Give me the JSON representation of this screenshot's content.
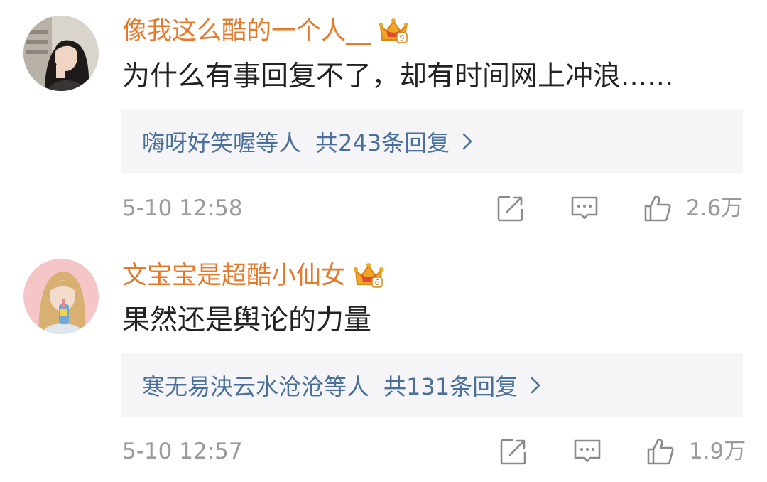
{
  "comments": [
    {
      "username": "像我这么酷的一个人__",
      "text": "为什么有事回复不了，却有时间网上冲浪......",
      "reply_users": "嗨呀好笑喔",
      "reply_suffix": "等人",
      "reply_count": "共243条回复",
      "timestamp": "5-10 12:58",
      "likes": "2.6万",
      "crown_level": "9"
    },
    {
      "username": "文宝宝是超酷小仙女",
      "text": "果然还是舆论的力量",
      "reply_users": "寒无易泱云水沧沧",
      "reply_suffix": "等人",
      "reply_count": "共131条回复",
      "timestamp": "5-10 12:57",
      "likes": "1.9万",
      "crown_level": "6"
    }
  ],
  "colors": {
    "username": "#e7792b",
    "link": "#4a6f9b",
    "meta": "#9a9a9a",
    "reply_bg": "#f5f5f7",
    "crown": "#f0a623"
  },
  "icons": {
    "share": "share-icon",
    "comment": "comment-icon",
    "like": "like-icon",
    "crown": "vip-crown-icon",
    "chevron": "chevron-right-icon"
  }
}
